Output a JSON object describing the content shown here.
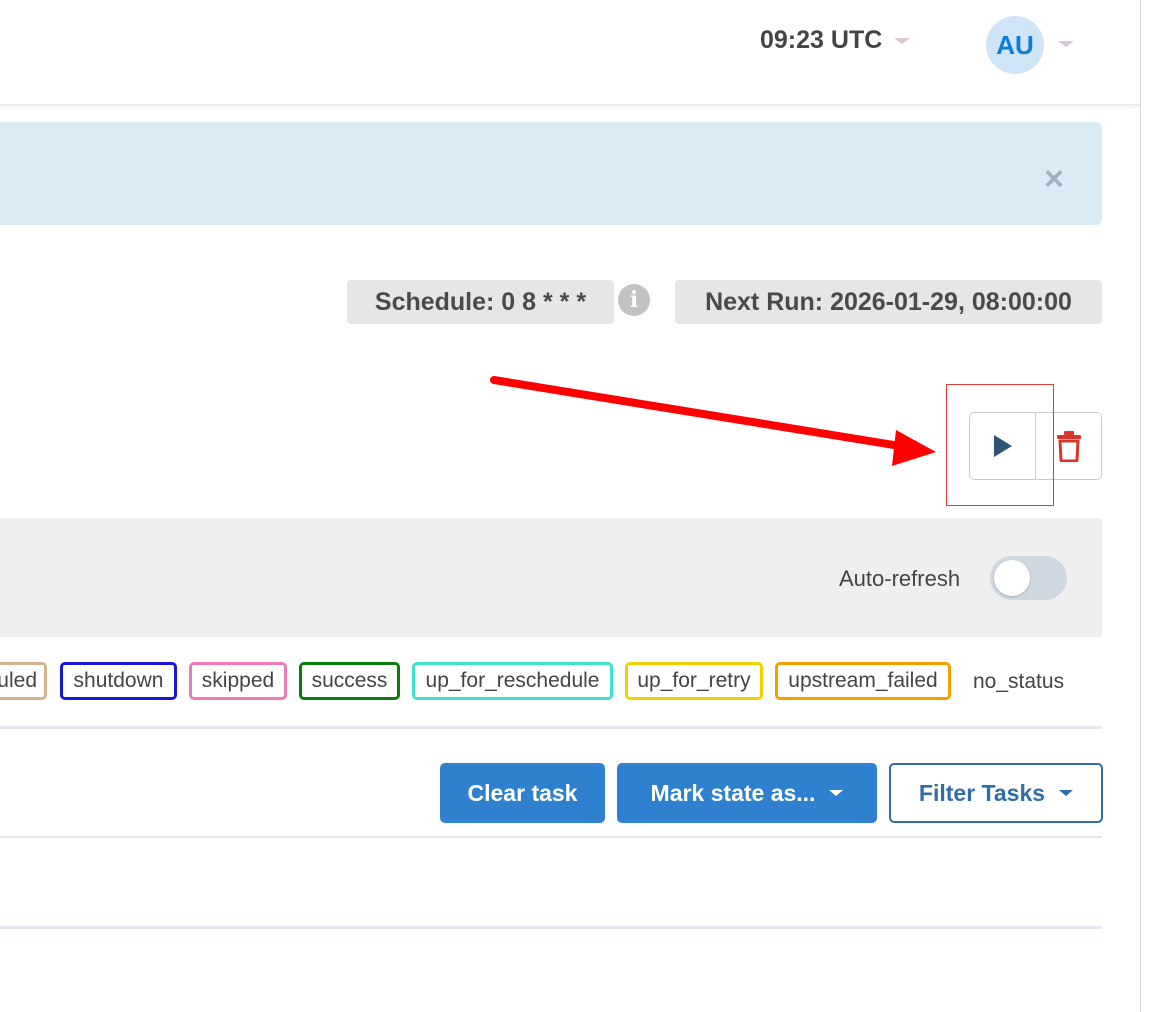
{
  "navbar": {
    "time_label": "09:23 UTC",
    "user_initials": "AU"
  },
  "banner": {
    "close_label": "×"
  },
  "schedule": {
    "schedule_label": "Schedule: 0 8 * * *",
    "info_label": "i",
    "next_run_label": "Next Run: 2026-01-29, 08:00:00"
  },
  "actions": {
    "trigger_icon": "play-icon",
    "delete_icon": "trash-icon"
  },
  "filters": {
    "auto_refresh_label": "Auto-refresh",
    "auto_refresh_on": false
  },
  "legend": {
    "states": [
      {
        "label": "uled",
        "color": "#d2b48c"
      },
      {
        "label": "shutdown",
        "color": "#1a16d9"
      },
      {
        "label": "skipped",
        "color": "#f07ab8"
      },
      {
        "label": "success",
        "color": "#0a7d0a"
      },
      {
        "label": "up_for_reschedule",
        "color": "#40e0d0"
      },
      {
        "label": "up_for_retry",
        "color": "#f5d000"
      },
      {
        "label": "upstream_failed",
        "color": "#f5a000"
      }
    ],
    "no_status_label": "no_status"
  },
  "task_actions": {
    "clear_label": "Clear task",
    "mark_state_label": "Mark state as...",
    "filter_label": "Filter Tasks"
  },
  "colors": {
    "primary": "#2f81d0",
    "annotation_red": "#ff0000"
  }
}
